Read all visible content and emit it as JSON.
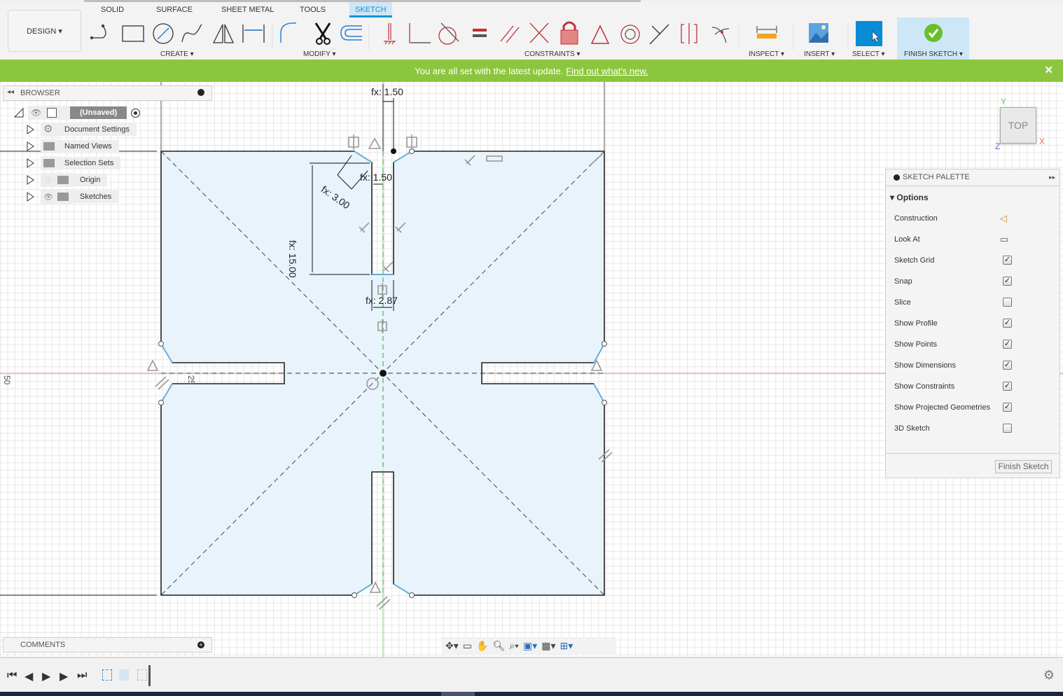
{
  "toolbar": {
    "workspace": "DESIGN ▾",
    "tabs": [
      {
        "label": "SOLID"
      },
      {
        "label": "SURFACE"
      },
      {
        "label": "SHEET METAL"
      },
      {
        "label": "TOOLS"
      },
      {
        "label": "SKETCH",
        "active": true
      }
    ],
    "groups": {
      "create": "CREATE ▾",
      "modify": "MODIFY ▾",
      "constraints": "CONSTRAINTS ▾",
      "inspect": "INSPECT ▾",
      "insert": "INSERT ▾",
      "select": "SELECT ▾",
      "finish": "FINISH SKETCH ▾"
    }
  },
  "banner": {
    "text": "You are all set with the latest update.",
    "link": "Find out what's new.",
    "close": "✕",
    "color": "#8cc63f"
  },
  "browser": {
    "title": "BROWSER",
    "root": "(Unsaved)",
    "items": [
      {
        "label": "Document Settings",
        "icon": "gear-icon"
      },
      {
        "label": "Named Views",
        "icon": "folder-icon"
      },
      {
        "label": "Selection Sets",
        "icon": "folder-icon"
      },
      {
        "label": "Origin",
        "icon": "folder-icon",
        "hidden": true
      },
      {
        "label": "Sketches",
        "icon": "folder-icon"
      }
    ]
  },
  "comments": {
    "title": "COMMENTS"
  },
  "viewcube": {
    "face": "TOP",
    "x": "X",
    "y": "Y",
    "z": "Z"
  },
  "sketch": {
    "dims": {
      "top_width": "fx: 1.50",
      "inner_width": "fx: 1.50",
      "chamfer": "fx: 3.00",
      "slot_length": "fx: 15.00",
      "slot_bottom": "fx: 2.87"
    },
    "ruler_left": "50",
    "ruler_mid": "25"
  },
  "palette": {
    "title": "SKETCH PALETTE",
    "section": "Options",
    "rows": [
      {
        "label": "Construction",
        "type": "icon"
      },
      {
        "label": "Look At",
        "type": "icon"
      },
      {
        "label": "Sketch Grid",
        "checked": true
      },
      {
        "label": "Snap",
        "checked": true
      },
      {
        "label": "Slice",
        "checked": false
      },
      {
        "label": "Show Profile",
        "checked": true
      },
      {
        "label": "Show Points",
        "checked": true
      },
      {
        "label": "Show Dimensions",
        "checked": true
      },
      {
        "label": "Show Constraints",
        "checked": true
      },
      {
        "label": "Show Projected Geometries",
        "checked": true
      },
      {
        "label": "3D Sketch",
        "checked": false
      }
    ],
    "finish": "Finish Sketch"
  },
  "colors": {
    "accent": "#0696d7",
    "profile": "#e8f3fc",
    "x_axis": "#e06060",
    "y_axis": "#70d070",
    "chamfer": "#5ab4e6"
  }
}
